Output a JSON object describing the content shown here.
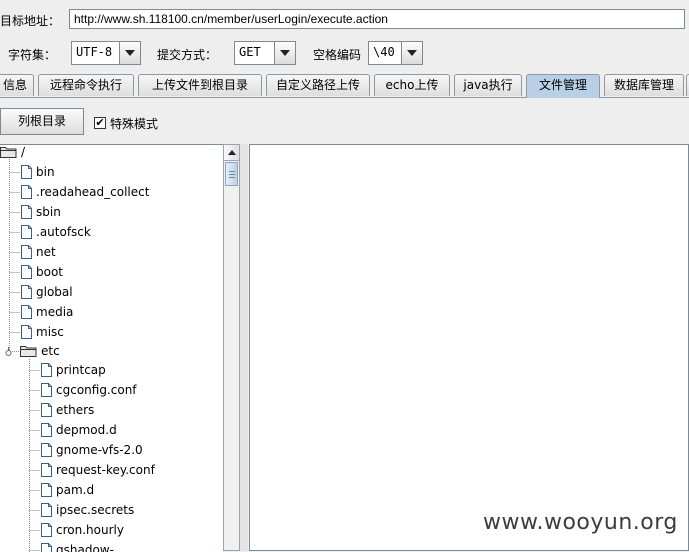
{
  "target": {
    "label": "目标地址：",
    "url": "http://www.sh.118100.cn/member/userLogin/execute.action"
  },
  "options": {
    "charset_label": "字符集：",
    "charset_value": "UTF-8",
    "method_label": "提交方式：",
    "method_value": "GET",
    "space_label": "空格编码",
    "space_value": "\\40"
  },
  "tabs": [
    {
      "label": "信息"
    },
    {
      "label": "远程命令执行"
    },
    {
      "label": "上传文件到根目录"
    },
    {
      "label": "自定义路径上传"
    },
    {
      "label": "echo上传"
    },
    {
      "label": "java执行"
    },
    {
      "label": "文件管理",
      "active": true
    },
    {
      "label": "数据库管理"
    }
  ],
  "toolbar": {
    "list_root_label": "列根目录",
    "special_mode_label": "特殊模式",
    "special_mode_checked": true
  },
  "tree": {
    "root": "/",
    "items": [
      {
        "name": "bin",
        "type": "file"
      },
      {
        "name": ".readahead_collect",
        "type": "file"
      },
      {
        "name": "sbin",
        "type": "file"
      },
      {
        "name": ".autofsck",
        "type": "file"
      },
      {
        "name": "net",
        "type": "file"
      },
      {
        "name": "boot",
        "type": "file"
      },
      {
        "name": "global",
        "type": "file"
      },
      {
        "name": "media",
        "type": "file"
      },
      {
        "name": "misc",
        "type": "file"
      },
      {
        "name": "etc",
        "type": "folder",
        "children": [
          {
            "name": "printcap",
            "type": "file"
          },
          {
            "name": "cgconfig.conf",
            "type": "file"
          },
          {
            "name": "ethers",
            "type": "file"
          },
          {
            "name": "depmod.d",
            "type": "file"
          },
          {
            "name": "gnome-vfs-2.0",
            "type": "file"
          },
          {
            "name": "request-key.conf",
            "type": "file"
          },
          {
            "name": "pam.d",
            "type": "file"
          },
          {
            "name": "ipsec.secrets",
            "type": "file"
          },
          {
            "name": "cron.hourly",
            "type": "file"
          },
          {
            "name": "gshadow-",
            "type": "file"
          }
        ]
      }
    ]
  },
  "watermark": "www.wooyun.org",
  "colors": {
    "active_tab": "#b8cfe5",
    "border": "#7a8a99",
    "tree_line": "#8a8a8a"
  }
}
